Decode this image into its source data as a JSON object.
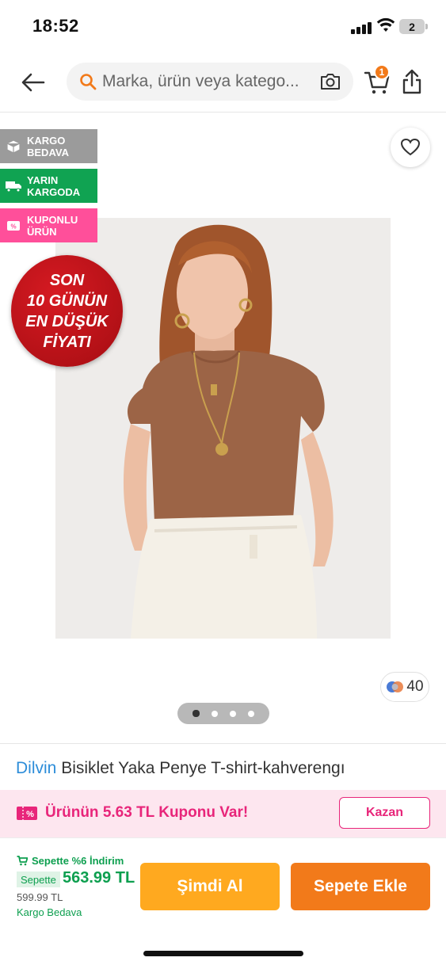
{
  "status_bar": {
    "time": "18:52",
    "battery": "2"
  },
  "header": {
    "search_placeholder": "Marka, ürün veya katego...",
    "cart_count": "1"
  },
  "badges": [
    {
      "label": "KARGO\nBEDAVA",
      "color": "#9b9b9b",
      "icon": "box-icon"
    },
    {
      "label": "YARIN\nKARGODA",
      "color": "#10a352",
      "icon": "truck-icon"
    },
    {
      "label": "KUPONLU\nÜRÜN",
      "color": "#ff4f9a",
      "icon": "coupon-icon"
    }
  ],
  "lowest_price_badge": {
    "line1": "SON",
    "line2": "10 GÜNÜN",
    "line3": "EN DÜŞÜK",
    "line4": "FİYATI"
  },
  "gallery": {
    "photo_count": "40",
    "pages": 4,
    "active_page": 1
  },
  "product": {
    "brand": "Dilvin",
    "name": "Bisiklet Yaka Penye T-shirt-kahverengı"
  },
  "coupon": {
    "text": "Ürünün 5.63 TL Kuponu Var!",
    "button": "Kazan"
  },
  "pricing": {
    "discount_text": "Sepette %6 İndirim",
    "tag": "Sepette",
    "price": "563.99 TL",
    "old_price": "599.99 TL",
    "shipping": "Kargo Bedava"
  },
  "actions": {
    "buy_now": "Şimdi Al",
    "add_to_cart": "Sepete Ekle"
  },
  "colors": {
    "accent": "#f27a1a",
    "buy_now": "#ffa91f",
    "green": "#0d9f4f",
    "pink": "#e8257a",
    "brand_blue": "#2d8dd9"
  }
}
